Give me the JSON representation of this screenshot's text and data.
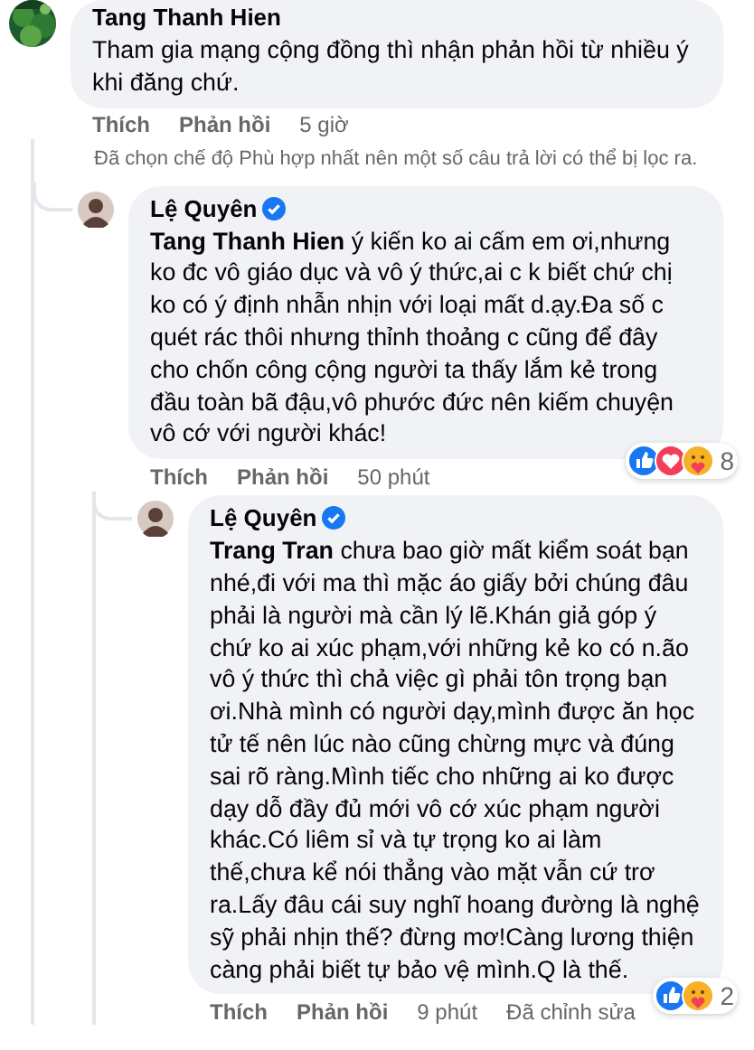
{
  "comments": [
    {
      "author": "Tang Thanh Hien",
      "verified": false,
      "text": "Tham gia mạng cộng đồng thì nhận phản hồi từ nhiều ý khi đăng chứ.",
      "like": "Thích",
      "reply": "Phản hồi",
      "time": "5 giờ",
      "filter_note": "Đã chọn chế độ Phù hợp nhất nên một số câu trả lời có thể bị lọc ra.",
      "replies": [
        {
          "author": "Lệ Quyên",
          "verified": true,
          "text": "**Tang Thanh Hien** ý kiến ko ai cấm em ơi,nhưng ko đc vô giáo dục và vô ý thức,ai c k biết chứ chị ko có ý định nhẫn nhịn với loại mất d.ạy.Đa số c quét rác thôi nhưng thỉnh thoảng c cũng để đây cho chốn công cộng người ta thấy lắm kẻ trong đầu toàn bã đậu,vô phước đức nên kiếm chuyện vô cớ với người khác!",
          "like": "Thích",
          "reply": "Phản hồi",
          "time": "50 phút",
          "reactions": [
            {
              "kind": "like"
            },
            {
              "kind": "love"
            },
            {
              "kind": "care"
            }
          ],
          "reaction_count": "8",
          "replies": [
            {
              "author": "Lệ Quyên",
              "verified": true,
              "text": "**Trang Tran** chưa bao giờ mất kiểm soát bạn nhé,đi với ma thì mặc áo giấy bởi chúng đâu phải là người mà cần lý lẽ.Khán giả góp ý chứ ko ai xúc phạm,với những kẻ ko có n.ão vô ý thức thì chả việc gì phải tôn trọng bạn ơi.Nhà mình có người dạy,mình được ăn học tử tế nên lúc nào cũng chừng mực và đúng sai rõ ràng.Mình tiếc cho những ai ko được dạy dỗ đầy đủ mới vô cớ xúc phạm người khác.Có liêm sỉ và tự trọng ko ai làm thế,chưa kể nói thẳng vào mặt vẫn cứ trơ ra.Lấy đâu cái suy nghĩ hoang đường là nghệ sỹ phải nhịn thế? đừng mơ!Càng lương thiện càng phải biết tự bảo vệ mình.Q là thế.",
              "like": "Thích",
              "reply": "Phản hồi",
              "time": "9 phút",
              "edited": "Đã chỉnh sửa",
              "reactions": [
                {
                  "kind": "like"
                },
                {
                  "kind": "care"
                }
              ],
              "reaction_count": "2"
            }
          ]
        }
      ]
    }
  ]
}
